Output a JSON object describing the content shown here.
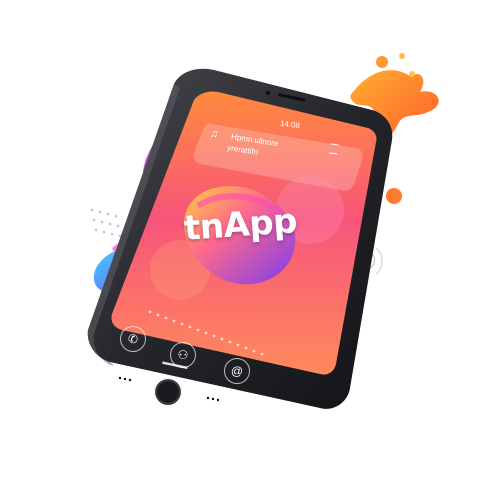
{
  "status_bar": {
    "time": "14:08"
  },
  "notification": {
    "line1": "Hpmn ullnore",
    "line2": "yrerattifn",
    "icon": "music-note-icon"
  },
  "app": {
    "logo_text": "tnApp"
  },
  "dock": {
    "items": [
      {
        "name": "phone",
        "icon": "phone-icon",
        "glyph": "✆"
      },
      {
        "name": "contacts",
        "icon": "person-icon",
        "glyph": "⚇"
      },
      {
        "name": "mail",
        "icon": "at-icon",
        "glyph": "@"
      }
    ]
  },
  "colors": {
    "screen_top": "#ff6a3d",
    "screen_mid": "#f7509a",
    "screen_bottom": "#ff8a5c",
    "blob_orange": "#ff9a2e",
    "blob_purple": "#8a3cf0",
    "blob_blue": "#3fa8ff",
    "phone_body": "#1f2024"
  }
}
